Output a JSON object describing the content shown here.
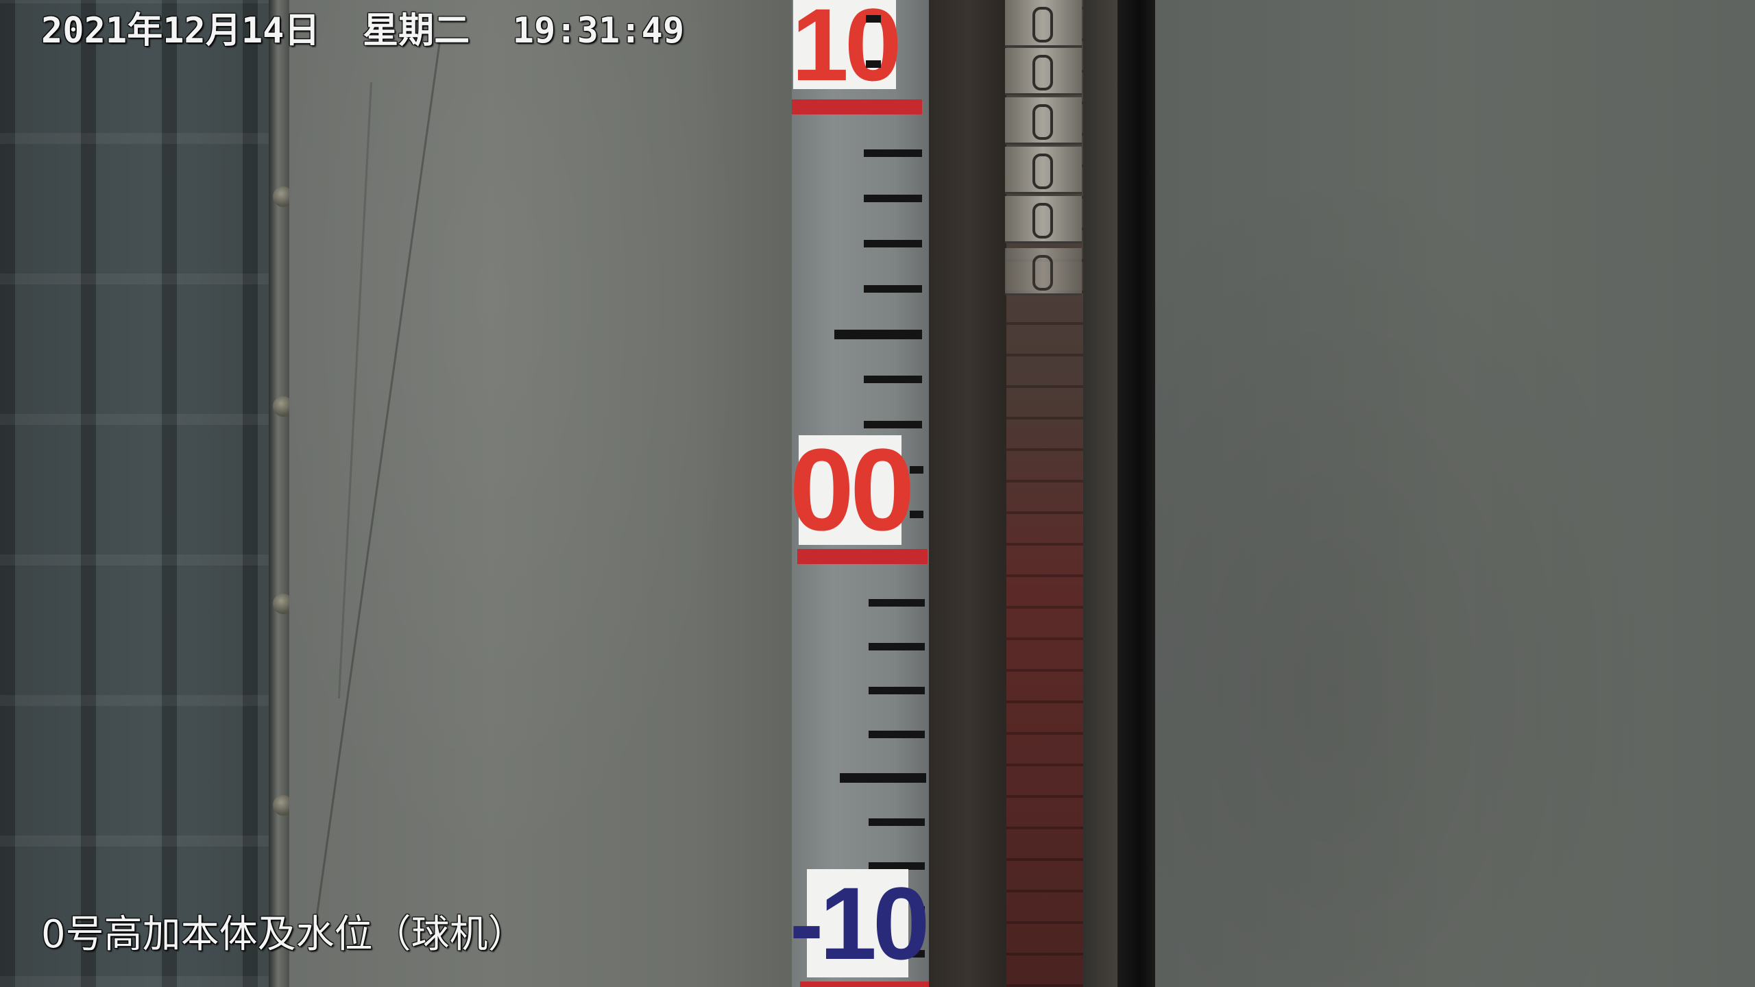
{
  "osd": {
    "timestamp": "2021年12月14日  星期二  19:31:49",
    "camera_name": "0号高加本体及水位（球机）"
  },
  "scale": {
    "labels": [
      "10",
      "00",
      "-10"
    ],
    "label_colors": {
      "positive": "#e03a30",
      "zero": "#e03a30",
      "negative": "#2a2a7a"
    },
    "red_line_color": "#c62a2e"
  }
}
